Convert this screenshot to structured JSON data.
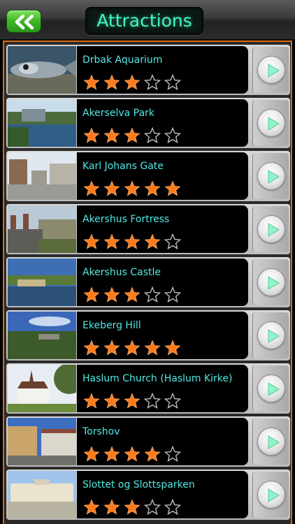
{
  "header": {
    "title": "Attractions",
    "back_icon": "double-chevron-left-icon"
  },
  "colors": {
    "accent_orange": "#d86a14",
    "title_text": "#41f7c4",
    "item_text": "#52e8e4",
    "star_filled": "#ff7a1a",
    "star_empty": "#bbbbbb"
  },
  "attractions": [
    {
      "name": "Drbak Aquarium",
      "rating": 3
    },
    {
      "name": "Akerselva Park",
      "rating": 3
    },
    {
      "name": "Karl Johans Gate",
      "rating": 5
    },
    {
      "name": "Akershus Fortress",
      "rating": 4
    },
    {
      "name": "Akershus Castle",
      "rating": 3
    },
    {
      "name": "Ekeberg Hill",
      "rating": 5
    },
    {
      "name": "Haslum Church (Haslum Kirke)",
      "rating": 3
    },
    {
      "name": "Torshov",
      "rating": 4
    },
    {
      "name": "Slottet og Slottsparken",
      "rating": 3
    }
  ]
}
